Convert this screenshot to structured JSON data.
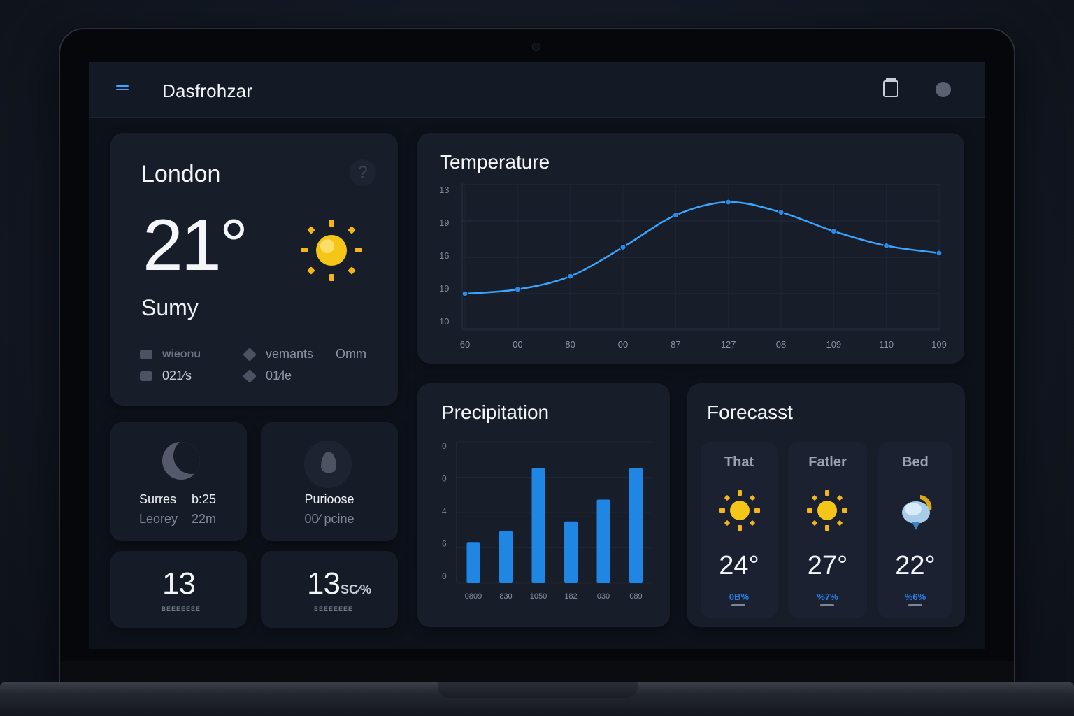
{
  "header": {
    "app_title": "Dasfrohzar"
  },
  "current": {
    "city": "London",
    "temperature": "21°",
    "condition": "Sumy",
    "meta": [
      {
        "icon": "briefcase-icon",
        "label": "wieonu"
      },
      {
        "icon": "diamond-icon",
        "label": "vemants"
      },
      {
        "icon": "",
        "label": "Omm"
      },
      {
        "icon": "thermometer-icon",
        "label": "021⁄s"
      },
      {
        "icon": "wind-icon",
        "label": "01⁄le"
      }
    ],
    "help_glyph": "?"
  },
  "tiles": {
    "moon": {
      "line1_a": "Surres",
      "line1_b": "b:25",
      "line2_a": "Leorey",
      "line2_b": "22m"
    },
    "purpose": {
      "line1": "Purioose",
      "line2": "00⁄ pcine"
    },
    "num1": {
      "value": "13",
      "label": "BEEEEEEE"
    },
    "num2": {
      "value": "13",
      "suffix": "SC⁄%",
      "label": "BEEEEEEE"
    }
  },
  "temperature_chart_title": "Temperature",
  "precipitation_chart_title": "Precipitation",
  "chart_data": [
    {
      "type": "line",
      "title": "Temperature",
      "x": [
        "60",
        "00",
        "80",
        "00",
        "87",
        "127",
        "08",
        "109",
        "110",
        "109"
      ],
      "y_ticks": [
        "13",
        "19",
        "16",
        "19",
        "10"
      ],
      "values": [
        0.24,
        0.27,
        0.36,
        0.56,
        0.78,
        0.87,
        0.8,
        0.67,
        0.57,
        0.52
      ],
      "color": "#3aa6ff",
      "grid": true
    },
    {
      "type": "bar",
      "title": "Precipitation",
      "categories": [
        "0809",
        "830",
        "1050",
        "182",
        "030",
        "089"
      ],
      "y_ticks": [
        "0",
        "0",
        "4",
        "6",
        "0"
      ],
      "values": [
        0.3,
        0.38,
        0.84,
        0.45,
        0.61,
        0.84
      ],
      "color": "#1f86e3"
    }
  ],
  "forecast": {
    "title": "Forecasst",
    "days": [
      {
        "name": "That",
        "temp": "24°",
        "pct": "0B%",
        "icon": "sun-icon"
      },
      {
        "name": "Fatler",
        "temp": "27°",
        "pct": "%7%",
        "icon": "sun-icon"
      },
      {
        "name": "Bed",
        "temp": "22°",
        "pct": "%6%",
        "icon": "cloud-icon"
      }
    ]
  }
}
